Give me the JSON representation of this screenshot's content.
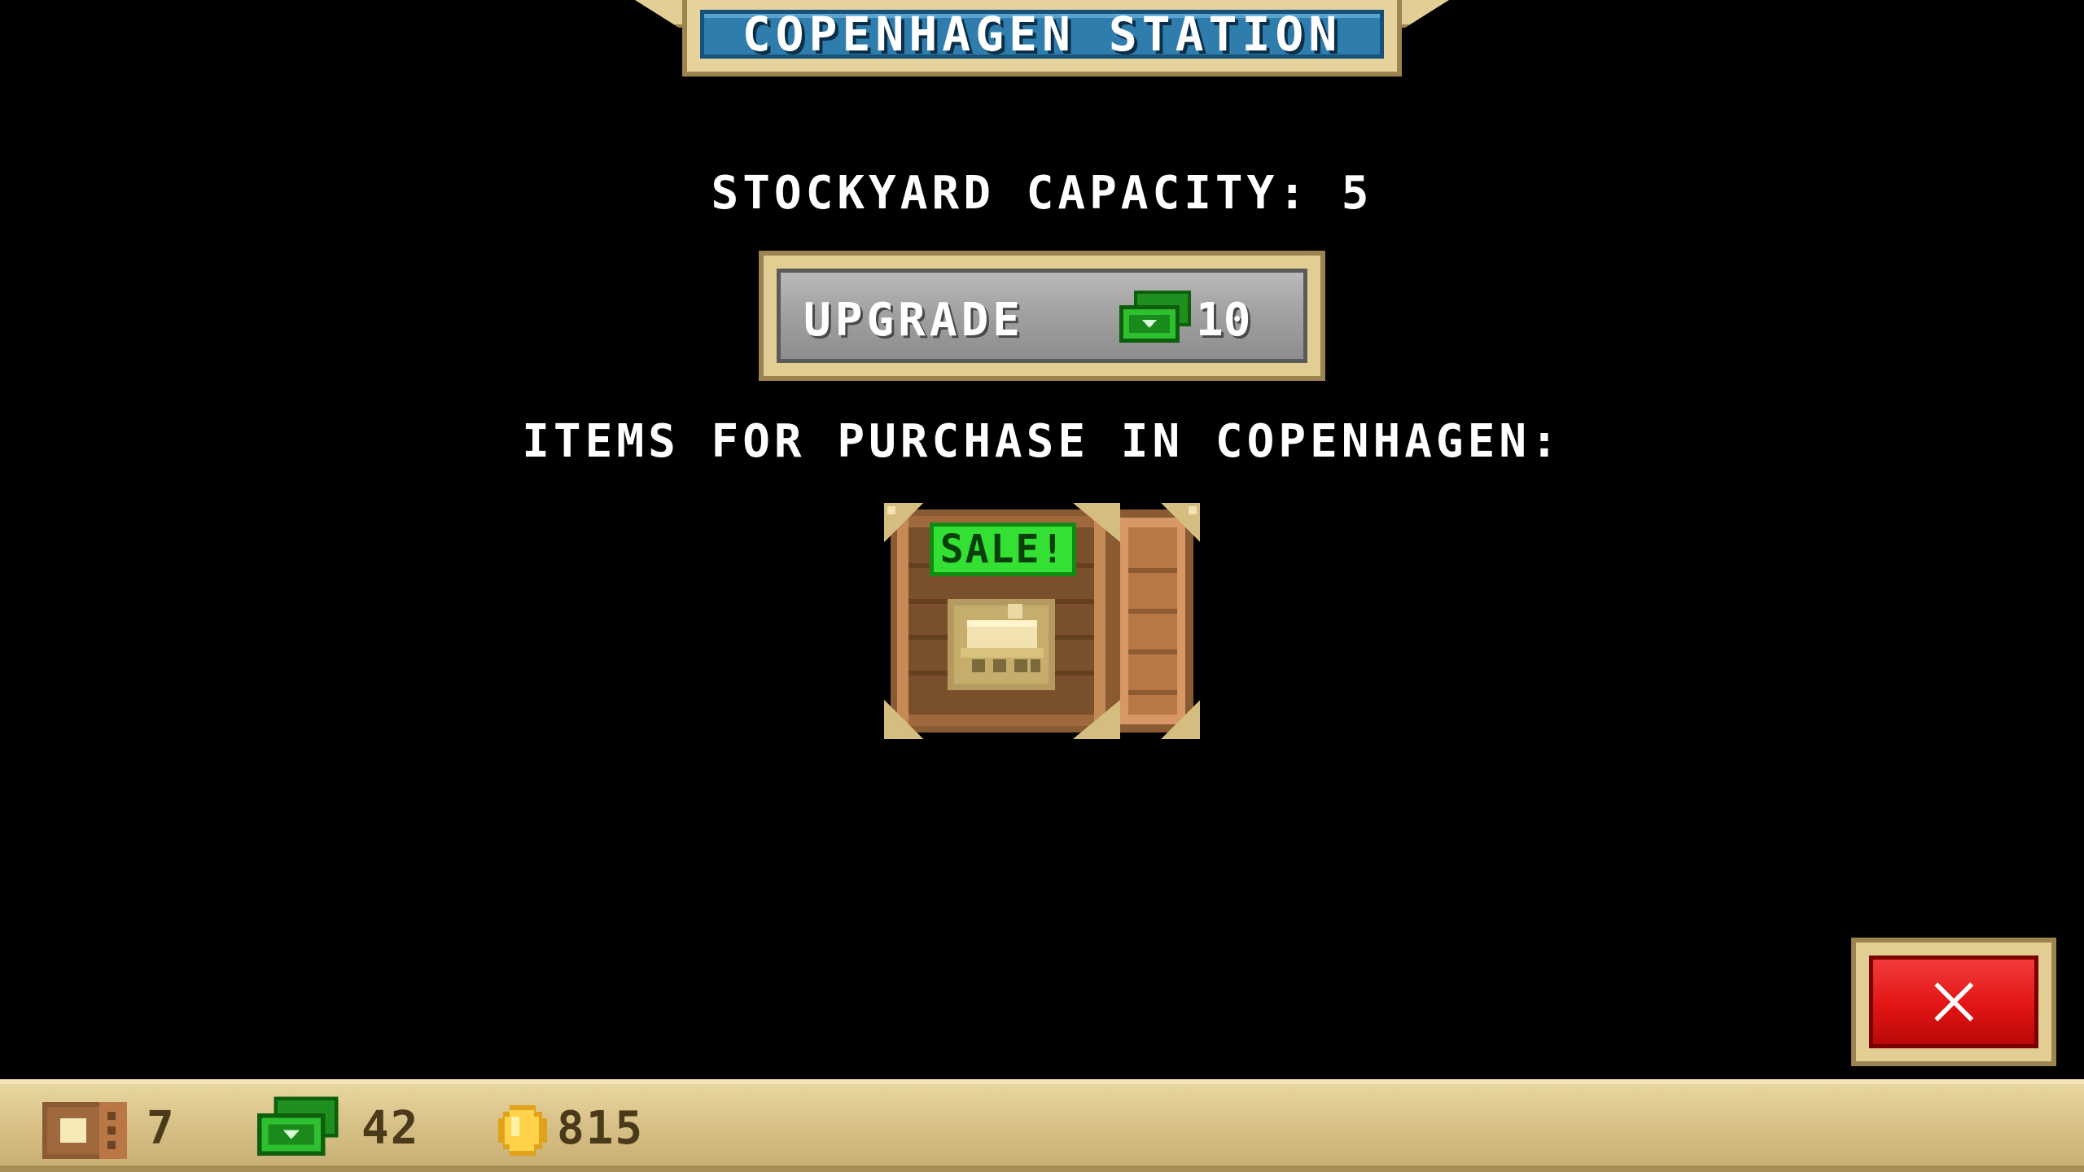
{
  "station": {
    "title": "COPENHAGEN STATION"
  },
  "stockyard": {
    "capacity_text": "STOCKYARD CAPACITY: 5"
  },
  "upgrade": {
    "label": "UPGRADE",
    "cost": "10",
    "currency_icon": "cash-icon"
  },
  "items": {
    "heading": "ITEMS FOR PURCHASE IN COPENHAGEN:",
    "list": [
      {
        "badge": "SALE!",
        "icon": "train-car-icon",
        "container_icon": "wooden-crate-icon"
      }
    ]
  },
  "close": {
    "icon": "close-x-icon"
  },
  "status_bar": {
    "crates": {
      "icon": "crate-icon",
      "value": "7"
    },
    "cash": {
      "icon": "cash-icon",
      "value": "42"
    },
    "coins": {
      "icon": "gold-coin-icon",
      "value": "815"
    }
  },
  "colors": {
    "background": "#000000",
    "frame_gold": "#e2cd93",
    "title_blue": "#2f7dad",
    "button_grey": "#a2a2a2",
    "sale_green": "#33e033",
    "close_red": "#e31414",
    "status_bar": "#d6bf85"
  }
}
